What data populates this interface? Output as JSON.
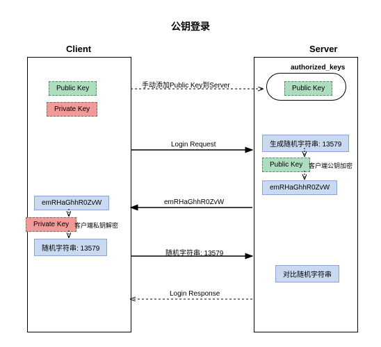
{
  "title": "公钥登录",
  "client": {
    "label": "Client",
    "public_key": "Public Key",
    "private_key": "Private Key",
    "private_key2": "Private Key",
    "decrypt_note": "客户端私钥解密",
    "cipher": "emRHaGhhR0ZvW",
    "plain": "随机字符串: 13579"
  },
  "server": {
    "label": "Server",
    "auth_file": "authorized_keys",
    "public_key": "Public Key",
    "gen": "生成随机字符串: 13579",
    "public_key2": "Public Key",
    "encrypt_note": "客户端公钥加密",
    "cipher": "emRHaGhhR0ZvW",
    "compare": "对比随机字符串"
  },
  "msg": {
    "add_pub": "手动添加Public Key到Server",
    "login_req": "Login Request",
    "cipher_back": "emRHaGhhR0ZvW",
    "plain_fwd": "随机字符串: 13579",
    "login_resp": "Login Response"
  },
  "chart_data": {
    "type": "sequence-diagram",
    "title": "公钥登录",
    "participants": [
      "Client",
      "Server"
    ],
    "client_state": [
      "Public Key",
      "Private Key"
    ],
    "server_state": [
      "authorized_keys: Public Key"
    ],
    "steps": [
      {
        "from": "Client",
        "to": "Server",
        "label": "手动添加Public Key到Server",
        "style": "dashed"
      },
      {
        "from": "Client",
        "to": "Server",
        "label": "Login Request",
        "style": "solid"
      },
      {
        "at": "Server",
        "action": "生成随机字符串: 13579"
      },
      {
        "at": "Server",
        "action": "客户端公钥加密",
        "input": "Public Key",
        "output": "emRHaGhhR0ZvW"
      },
      {
        "from": "Server",
        "to": "Client",
        "label": "emRHaGhhR0ZvW",
        "style": "solid"
      },
      {
        "at": "Client",
        "action": "客户端私钥解密",
        "input": "Private Key",
        "output": "随机字符串: 13579"
      },
      {
        "from": "Client",
        "to": "Server",
        "label": "随机字符串: 13579",
        "style": "solid"
      },
      {
        "at": "Server",
        "action": "对比随机字符串"
      },
      {
        "from": "Server",
        "to": "Client",
        "label": "Login Response",
        "style": "dashed"
      }
    ]
  }
}
